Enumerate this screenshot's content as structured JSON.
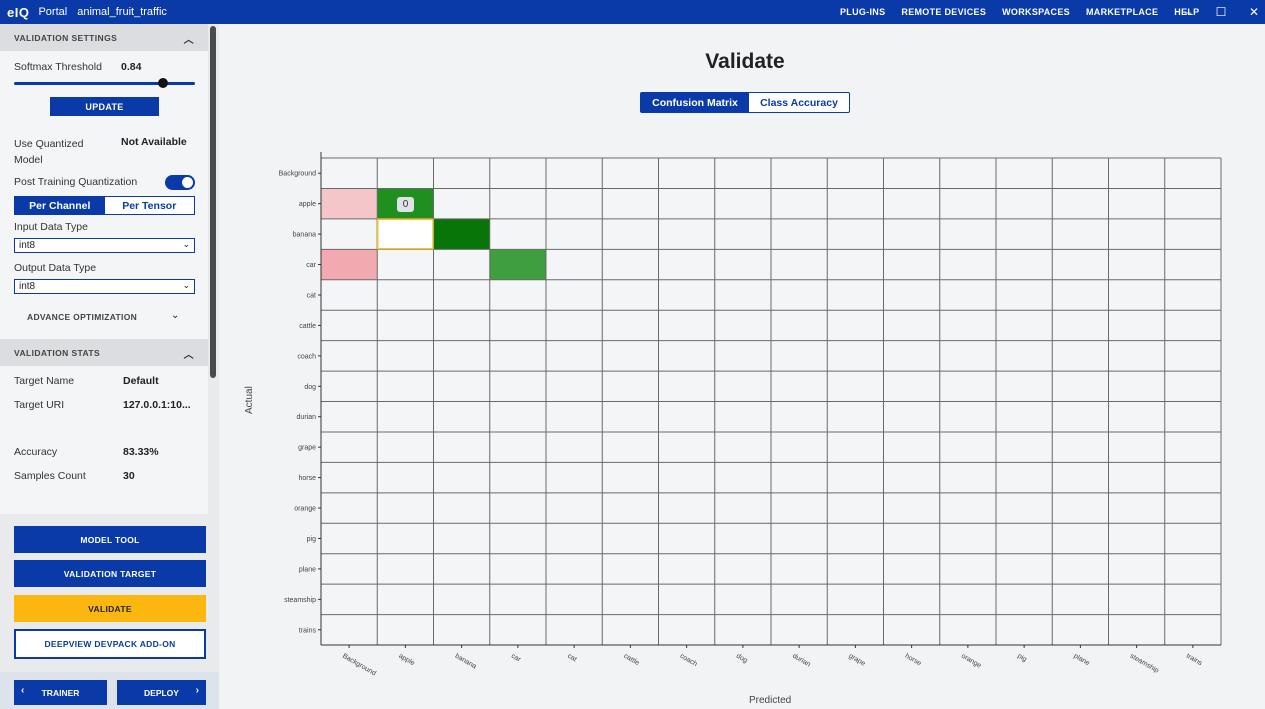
{
  "topbar": {
    "logo": "eIQ",
    "portal": "Portal",
    "project": "animal_fruit_traffic",
    "menu": [
      "PLUG-INS",
      "REMOTE DEVICES",
      "WORKSPACES",
      "MARKETPLACE",
      "HELP"
    ],
    "minimize": "–",
    "maximize": "☐",
    "close": "✕"
  },
  "sidebar": {
    "validation_settings": "VALIDATION SETTINGS",
    "softmax_label": "Softmax Threshold",
    "softmax_value": "0.84",
    "softmax_level": 0.84,
    "update": "UPDATE",
    "quantized_label": "Use Quantized Model",
    "quantized_value": "Not Available",
    "ptq_label": "Post Training Quantization",
    "ptq_on": true,
    "per_channel": "Per Channel",
    "per_tensor": "Per Tensor",
    "input_type_label": "Input Data Type",
    "input_type_value": "int8",
    "output_type_label": "Output Data Type",
    "output_type_value": "int8",
    "advance": "ADVANCE OPTIMIZATION",
    "validation_stats": "VALIDATION STATS",
    "target_name_label": "Target Name",
    "target_name_value": "Default",
    "target_uri_label": "Target URI",
    "target_uri_value": "127.0.0.1:10...",
    "accuracy_label": "Accuracy",
    "accuracy_value": "83.33%",
    "samples_label": "Samples Count",
    "samples_value": "30",
    "model_tool": "MODEL TOOL",
    "validation_target": "VALIDATION TARGET",
    "validate": "VALIDATE",
    "deepview": "DEEPVIEW DEVPACK ADD-ON",
    "trainer": "TRAINER",
    "deploy": "DEPLOY"
  },
  "main": {
    "title": "Validate",
    "tab_confusion": "Confusion Matrix",
    "tab_class_accuracy": "Class Accuracy",
    "tooltip_value": "0"
  },
  "chart_data": {
    "type": "heatmap",
    "title": "",
    "xlabel": "Predicted",
    "ylabel": "Actual",
    "categories": [
      "Background",
      "apple",
      "banana",
      "car",
      "cat",
      "cattle",
      "coach",
      "dog",
      "durian",
      "grape",
      "horse",
      "orange",
      "pig",
      "plane",
      "steamship",
      "trains"
    ],
    "highlighted_cells": [
      {
        "actual": "apple",
        "predicted": "Background",
        "color": "#f4c6ca"
      },
      {
        "actual": "apple",
        "predicted": "apple",
        "color": "#1f8f1f"
      },
      {
        "actual": "banana",
        "predicted": "apple",
        "color": "#ffffff",
        "outline": "#e8c23a"
      },
      {
        "actual": "banana",
        "predicted": "banana",
        "color": "#077507"
      },
      {
        "actual": "car",
        "predicted": "Background",
        "color": "#f2aab0"
      },
      {
        "actual": "car",
        "predicted": "car",
        "color": "#3f9e3f"
      }
    ]
  }
}
